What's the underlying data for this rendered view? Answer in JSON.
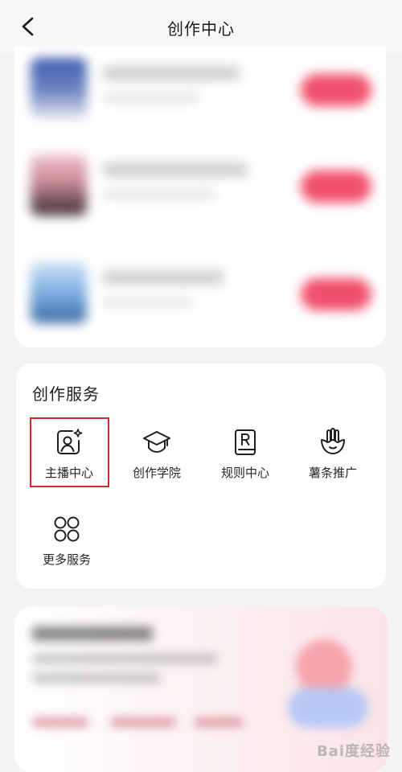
{
  "header": {
    "title": "创作中心",
    "back_icon": "chevron-left-icon"
  },
  "services": {
    "title": "创作服务",
    "items": [
      {
        "label": "主播中心",
        "icon": "anchor-profile-icon",
        "highlighted": true
      },
      {
        "label": "创作学院",
        "icon": "graduation-cap-icon",
        "highlighted": false
      },
      {
        "label": "规则中心",
        "icon": "rule-book-icon",
        "highlighted": false
      },
      {
        "label": "薯条推广",
        "icon": "fries-icon",
        "highlighted": false
      },
      {
        "label": "更多服务",
        "icon": "grid-circles-icon",
        "highlighted": false
      }
    ]
  },
  "colors": {
    "highlight_border": "#d9252f",
    "accent": "#f0506c"
  },
  "watermark": {
    "text": "Bai度经验"
  }
}
